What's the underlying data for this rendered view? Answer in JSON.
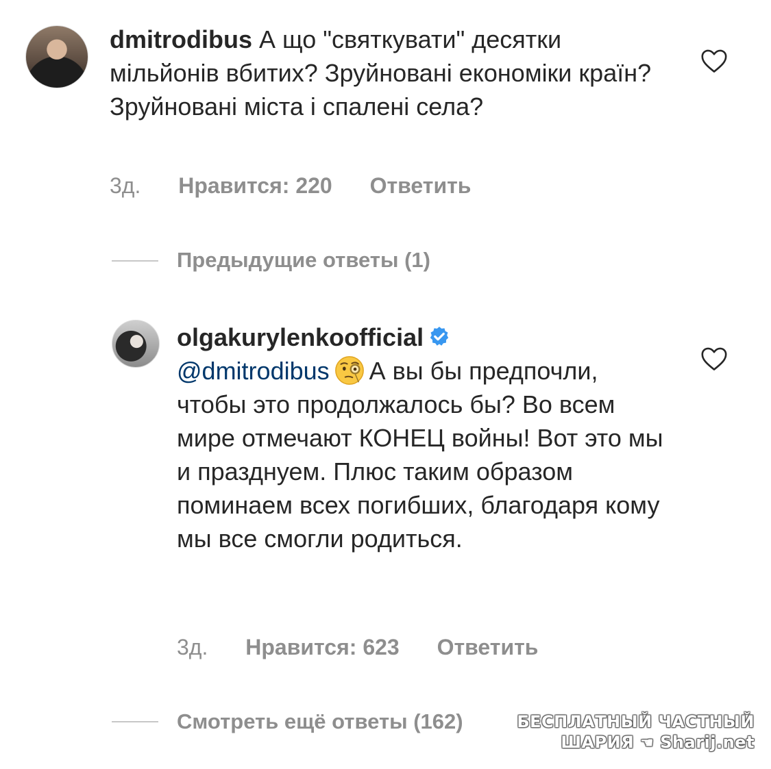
{
  "comment1": {
    "username": "dmitrodibus",
    "text": "А що \"святкувати\" десятки мільйонів вбитих? Зруйновані економіки країн? Зруйновані міста і спалені села?",
    "time": "3д.",
    "likes": "Нравится: 220",
    "reply": "Ответить",
    "heart_icon": "heart-outline-icon"
  },
  "previous_replies": "Предыдущие ответы (1)",
  "comment2": {
    "username": "olgakurylenkoofficial",
    "verified": true,
    "mention": "@dmitrodibus",
    "emoji": "face-with-monocle",
    "text": "А вы бы предпочли, чтобы это продолжалось бы? Во всем мире отмечают КОНЕЦ войны! Вот это мы и празднуем. Плюс таким образом поминаем всех погибших, благодаря кому мы все смогли родиться.",
    "time": "3д.",
    "likes": "Нравится: 623",
    "reply": "Ответить",
    "heart_icon": "heart-outline-icon"
  },
  "more_replies": "Смотреть ещё ответы (162)",
  "watermark": {
    "line1": "БЕСПЛАТНЫЙ ЧАСТНЫЙ",
    "line2_left": "ШАРИЯ",
    "line2_right": "Sharij.net"
  },
  "colors": {
    "text": "#262626",
    "secondary": "#8e8e8e",
    "mention": "#00376b",
    "verified": "#3897f0"
  }
}
